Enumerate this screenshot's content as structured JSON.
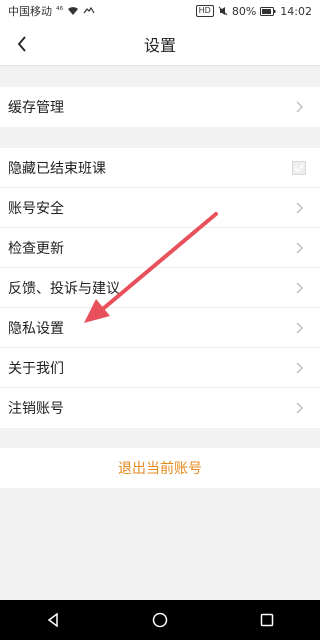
{
  "status_bar": {
    "carrier": "中国移动",
    "signal_text": "⁴⁶",
    "battery_percent": "80%",
    "hd_badge": "HD",
    "time": "14:02"
  },
  "header": {
    "title": "设置"
  },
  "groups": {
    "cache": {
      "label": "缓存管理"
    },
    "main": {
      "items": [
        {
          "label": "隐藏已结束班课",
          "control": "checkbox",
          "checked": true
        },
        {
          "label": "账号安全",
          "control": "chevron"
        },
        {
          "label": "检查更新",
          "control": "chevron"
        },
        {
          "label": "反馈、投诉与建议",
          "control": "chevron"
        },
        {
          "label": "隐私设置",
          "control": "chevron"
        },
        {
          "label": "关于我们",
          "control": "chevron"
        },
        {
          "label": "注销账号",
          "control": "chevron"
        }
      ]
    },
    "logout": {
      "label": "退出当前账号"
    }
  },
  "colors": {
    "accent": "#e58a1f",
    "annotation_arrow": "#e8505b"
  },
  "icons": [
    "back-chevron-icon",
    "chevron-right-icon",
    "checkbox-icon",
    "nav-back-icon",
    "nav-home-icon",
    "nav-recents-icon"
  ]
}
